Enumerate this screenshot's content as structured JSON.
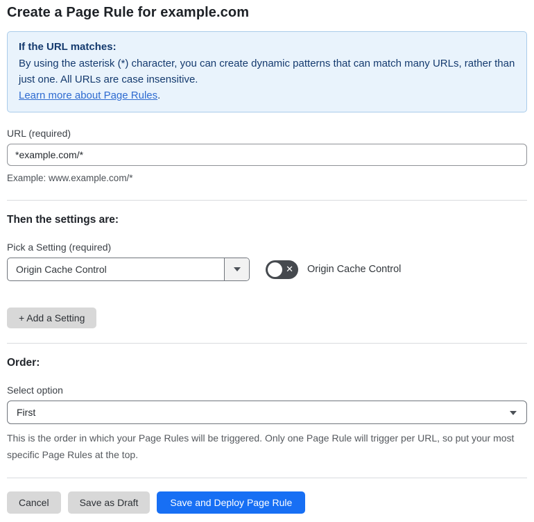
{
  "page": {
    "title": "Create a Page Rule for example.com"
  },
  "info_box": {
    "heading": "If the URL matches:",
    "body": "By using the asterisk (*) character, you can create dynamic patterns that can match many URLs, rather than just one. All URLs are case insensitive.",
    "link_label": "Learn more about Page Rules",
    "link_suffix": "."
  },
  "url_field": {
    "label": "URL (required)",
    "value": "*example.com/*",
    "helper": "Example: www.example.com/*"
  },
  "settings_section": {
    "heading": "Then the settings are:",
    "picker_label": "Pick a Setting (required)",
    "picker_value": "Origin Cache Control",
    "toggle_label": "Origin Cache Control",
    "toggle_state": "off",
    "toggle_glyph": "✕",
    "add_setting_label": "+ Add a Setting"
  },
  "order_section": {
    "heading": "Order:",
    "select_label": "Select option",
    "select_value": "First",
    "helper": "This is the order in which your Page Rules will be triggered. Only one Page Rule will trigger per URL, so put your most specific Page Rules at the top."
  },
  "actions": {
    "cancel_label": "Cancel",
    "save_draft_label": "Save as Draft",
    "save_deploy_label": "Save and Deploy Page Rule"
  },
  "colors": {
    "primary_blue": "#176ff4",
    "info_bg": "#e9f3fc",
    "info_border": "#a9cbea",
    "info_text": "#143a6e",
    "link_blue": "#2e6bd0",
    "toggle_off_bg": "#45494e",
    "gray_button_bg": "#d8d8d8"
  }
}
